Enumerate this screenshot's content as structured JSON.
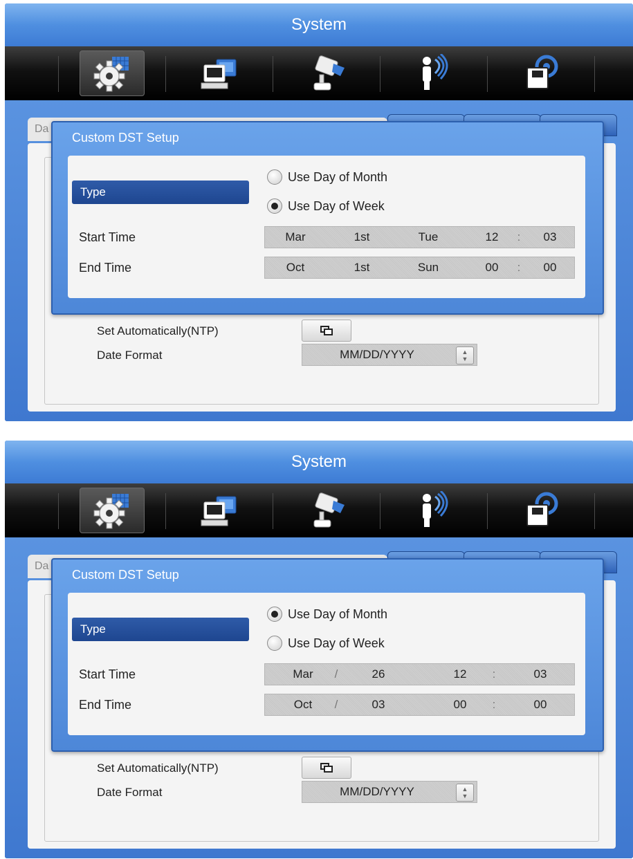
{
  "screens": [
    {
      "title": "System",
      "tab_stub_label": "Da",
      "dialog": {
        "title": "Custom DST Setup",
        "type_label": "Type",
        "radio_month": "Use Day of Month",
        "radio_week": "Use Day of Week",
        "selected": "week",
        "start_label": "Start Time",
        "end_label": "End Time",
        "start": {
          "c1": "Mar",
          "c2": "1st",
          "c3": "Tue",
          "hh": "12",
          "sep": ":",
          "mm": "03"
        },
        "end": {
          "c1": "Oct",
          "c2": "1st",
          "c3": "Sun",
          "hh": "00",
          "sep": ":",
          "mm": "00"
        }
      },
      "ntp_label": "Set Automatically(NTP)",
      "date_format_label": "Date Format",
      "date_format_value": "MM/DD/YYYY"
    },
    {
      "title": "System",
      "tab_stub_label": "Da",
      "dialog": {
        "title": "Custom DST Setup",
        "type_label": "Type",
        "radio_month": "Use Day of Month",
        "radio_week": "Use Day of Week",
        "selected": "month",
        "start_label": "Start Time",
        "end_label": "End Time",
        "start": {
          "c1": "Mar",
          "c2": "/",
          "c3": "26",
          "hh": "12",
          "sep": ":",
          "mm": "03"
        },
        "end": {
          "c1": "Oct",
          "c2": "/",
          "c3": "03",
          "hh": "00",
          "sep": ":",
          "mm": "00"
        }
      },
      "ntp_label": "Set Automatically(NTP)",
      "date_format_label": "Date Format",
      "date_format_value": "MM/DD/YYYY"
    }
  ],
  "toolbar_icons": [
    "system-settings-icon",
    "network-icon",
    "camera-device-icon",
    "event-icon",
    "storage-icon"
  ],
  "colors": {
    "accent_blue": "#3a6fc7",
    "dialog_blue": "#4d87d8",
    "type_pill": "#1e4690",
    "toolbar_black": "#111111"
  }
}
